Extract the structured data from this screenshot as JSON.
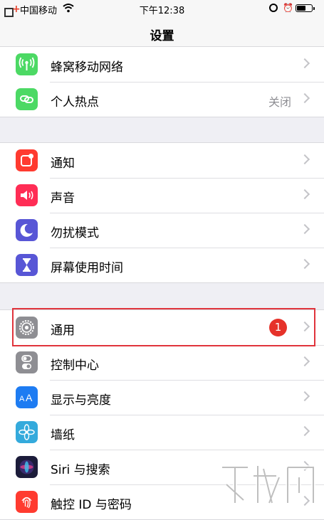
{
  "status": {
    "carrier": "中国移动",
    "time": "下午12:38"
  },
  "nav": {
    "title": "设置"
  },
  "groups": [
    {
      "rows": [
        {
          "label": "蜂窝移动网络",
          "icon": "cellular-icon",
          "color": "#4cd964"
        },
        {
          "label": "个人热点",
          "icon": "hotspot-icon",
          "color": "#4cd964",
          "detail": "关闭"
        }
      ]
    },
    {
      "rows": [
        {
          "label": "通知",
          "icon": "notifications-icon",
          "color": "#ff3b30"
        },
        {
          "label": "声音",
          "icon": "sound-icon",
          "color": "#ff2d55"
        },
        {
          "label": "勿扰模式",
          "icon": "moon-icon",
          "color": "#5856d6"
        },
        {
          "label": "屏幕使用时间",
          "icon": "hourglass-icon",
          "color": "#5856d6"
        }
      ]
    },
    {
      "rows": [
        {
          "label": "通用",
          "icon": "gear-icon",
          "color": "#8e8e93",
          "badge": "1"
        },
        {
          "label": "控制中心",
          "icon": "toggles-icon",
          "color": "#8e8e93"
        },
        {
          "label": "显示与亮度",
          "icon": "display-icon",
          "color": "#1e7cf2"
        },
        {
          "label": "墙纸",
          "icon": "wallpaper-icon",
          "color": "#34aadc"
        },
        {
          "label": "Siri 与搜索",
          "icon": "siri-icon",
          "color": "#1c1c3a"
        },
        {
          "label": "触控 ID 与密码",
          "icon": "fingerprint-icon",
          "color": "#ff3b30"
        }
      ]
    }
  ]
}
